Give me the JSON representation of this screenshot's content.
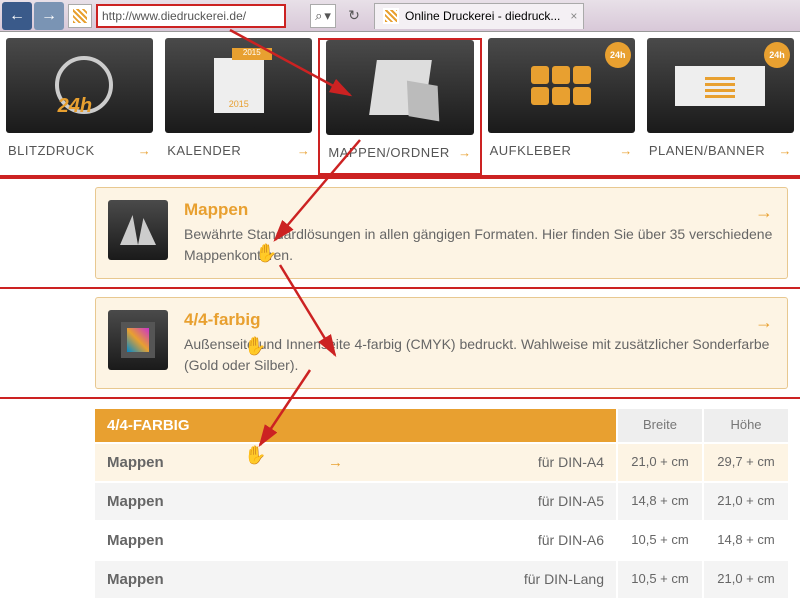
{
  "browser": {
    "url": "http://www.diedruckerei.de/",
    "tab_title": "Online Druckerei - diedruck...",
    "search_icon": "⌕",
    "refresh_icon": "↻",
    "dropdown_icon": "▾"
  },
  "categories": [
    {
      "label": "BLITZDRUCK",
      "icon": "clock"
    },
    {
      "label": "KALENDER",
      "icon": "cal"
    },
    {
      "label": "MAPPEN/ORDNER",
      "icon": "folder",
      "highlight": true
    },
    {
      "label": "AUFKLEBER",
      "icon": "stick",
      "badge": "24h"
    },
    {
      "label": "PLANEN/BANNER",
      "icon": "banner",
      "badge": "24h"
    }
  ],
  "cards": [
    {
      "title": "Mappen",
      "desc": "Bewährte Standardlösungen in allen gängigen Formaten. Hier finden Sie über 35 verschiedene Mappenkonturen."
    },
    {
      "title": "4/4-farbig",
      "desc": "Außenseite und Innenseite 4-farbig (CMYK) bedruckt. Wahlweise mit zusätzlicher Sonderfarbe (Gold oder Silber)."
    }
  ],
  "table": {
    "title": "4/4-FARBIG",
    "col_width": "Breite",
    "col_height": "Höhe",
    "rows": [
      {
        "name": "Mappen",
        "format": "für DIN-A4",
        "w": "21,0 + cm",
        "h": "29,7 + cm",
        "hl": true
      },
      {
        "name": "Mappen",
        "format": "für DIN-A5",
        "w": "14,8 + cm",
        "h": "21,0 + cm"
      },
      {
        "name": "Mappen",
        "format": "für DIN-A6",
        "w": "10,5 + cm",
        "h": "14,8 + cm"
      },
      {
        "name": "Mappen",
        "format": "für DIN-Lang",
        "w": "10,5 + cm",
        "h": "21,0 + cm"
      }
    ]
  },
  "arrow_glyph": "→"
}
